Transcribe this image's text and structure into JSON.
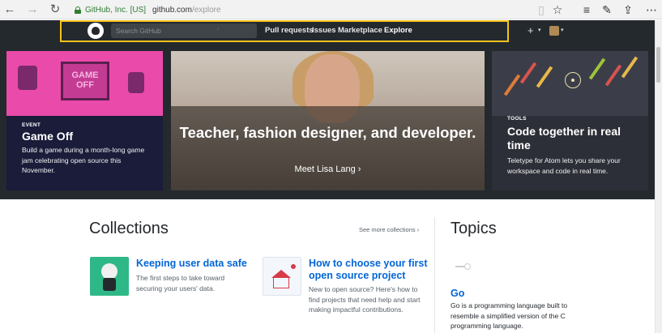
{
  "browser": {
    "back": "←",
    "forward": "→",
    "refresh": "↻",
    "org": "GitHub, Inc. [US]",
    "url_host": "github.com",
    "url_path": "/explore",
    "icons": [
      "reading-view-icon",
      "favorite-star-icon",
      "hub-icon",
      "notes-icon",
      "share-icon",
      "more-icon"
    ],
    "glyphs": {
      "reading": "▯",
      "star": "☆",
      "hub": "≡",
      "notes": "✎",
      "share": "⇪",
      "more": "⋯"
    }
  },
  "header": {
    "search_placeholder": "Search GitHub",
    "search_shortcut": "/",
    "nav": [
      "Pull requests",
      "Issues",
      "Marketplace",
      "Explore"
    ],
    "plus": "+",
    "caret": "▾",
    "highlight_color": "#f6c21b"
  },
  "hero": {
    "gameoff": {
      "art_text": "GAME OFF",
      "eyebrow": "EVENT",
      "title": "Game Off",
      "desc": "Build a game during a month-long game jam celebrating open source this November."
    },
    "feature": {
      "title": "Teacher, fashion designer, and developer.",
      "link": "Meet Lisa Lang ›"
    },
    "atom": {
      "eyebrow": "TOOLS",
      "title": "Code together in real time",
      "desc": "Teletype for Atom lets you share your workspace and code in real time."
    }
  },
  "collections": {
    "heading": "Collections",
    "see_more": "See more collections ›",
    "items": [
      {
        "title": "Keeping user data safe",
        "desc": "The first steps to take toward securing your users' data."
      },
      {
        "title": "How to choose your first open source project",
        "desc": "New to open source? Here's how to find projects that need help and start making impactful contributions."
      }
    ]
  },
  "topics": {
    "heading": "Topics",
    "item": {
      "title": "Go",
      "desc": "Go is a programming language built to resemble a simplified version of the C programming language."
    }
  }
}
